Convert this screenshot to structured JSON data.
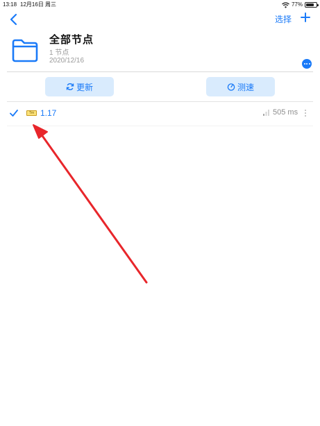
{
  "status_bar": {
    "time": "13:18",
    "date": "12月16日 周三",
    "battery_percent": "77%"
  },
  "nav": {
    "select_label": "选择"
  },
  "header": {
    "title": "全部节点",
    "node_count": "1 节点",
    "date": "2020/12/16"
  },
  "actions": {
    "refresh_label": "更新",
    "speedtest_label": "测速"
  },
  "nodes": [
    {
      "badge": "Trn",
      "name": "1.17",
      "latency": "505 ms",
      "selected": true
    }
  ],
  "annotation": {
    "arrow_color": "#e8262b"
  },
  "colors": {
    "accent": "#1a7af8",
    "button_bg": "#d9ebfd",
    "muted_text": "#9a9a9a"
  },
  "icons": [
    "back-chevron-icon",
    "add-icon",
    "folder-icon",
    "more-icon",
    "refresh-icon",
    "speedometer-icon",
    "check-icon",
    "signal-icon",
    "vertical-dots-icon",
    "wifi-icon",
    "battery-icon"
  ]
}
